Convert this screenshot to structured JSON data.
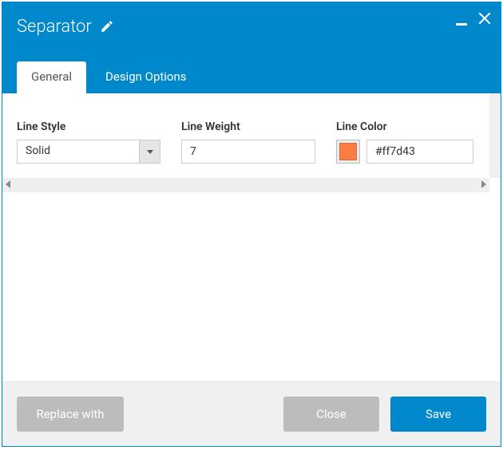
{
  "header": {
    "title": "Separator"
  },
  "tabs": {
    "items": [
      {
        "label": "General",
        "active": true
      },
      {
        "label": "Design Options",
        "active": false
      }
    ]
  },
  "fields": {
    "lineStyle": {
      "label": "Line Style",
      "value": "Solid"
    },
    "lineWeight": {
      "label": "Line Weight",
      "value": "7"
    },
    "lineColor": {
      "label": "Line Color",
      "value": "#ff7d43",
      "swatch": "#ff7d43"
    }
  },
  "footer": {
    "replace": "Replace with",
    "close": "Close",
    "save": "Save"
  }
}
